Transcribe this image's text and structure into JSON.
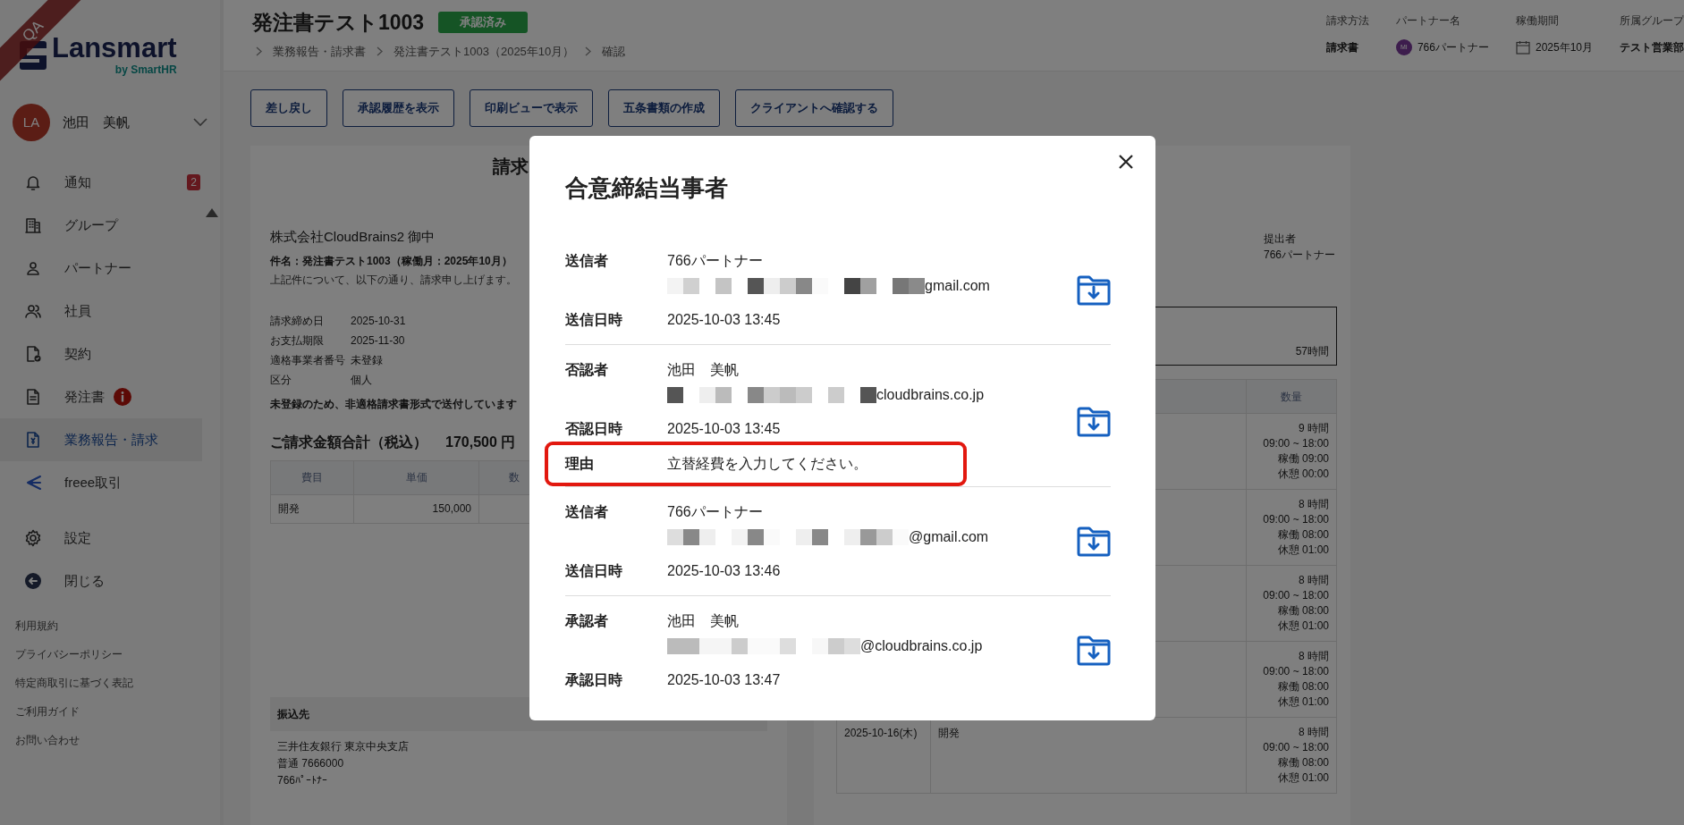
{
  "sidebar": {
    "env_ribbon": "QA",
    "logo": "Lansmart",
    "logo_sub": "by SmartHR",
    "user": {
      "initials": "LA",
      "name": "池田　美帆"
    },
    "nav": [
      {
        "label": "通知",
        "badge": "2",
        "alert": false,
        "selected": false
      },
      {
        "label": "グループ",
        "alert": false,
        "selected": false
      },
      {
        "label": "パートナー",
        "alert": false,
        "selected": false
      },
      {
        "label": "社員",
        "alert": false,
        "selected": false
      },
      {
        "label": "契約",
        "alert": false,
        "selected": false
      },
      {
        "label": "発注書",
        "alert": true,
        "selected": false
      },
      {
        "label": "業務報告・請求",
        "alert": false,
        "selected": true
      },
      {
        "label": "freee取引",
        "alert": false,
        "selected": false
      }
    ],
    "sub_nav": [
      {
        "label": "設定",
        "selected": false
      },
      {
        "label": "閉じる",
        "selected": false
      }
    ],
    "footer_links": [
      "利用規約",
      "プライバシーポリシー",
      "特定商取引に基づく表記",
      "ご利用ガイド",
      "お問い合わせ"
    ]
  },
  "header": {
    "title": "発注書テスト1003",
    "status": "承認済み",
    "breadcrumb": [
      "業務報告・請求書",
      "発注書テスト1003（2025年10月）",
      "確認"
    ],
    "meta": [
      {
        "kind": "text",
        "label": "請求方法",
        "value": "請求書"
      },
      {
        "kind": "avatar",
        "label": "パートナー名",
        "avatar": "MI",
        "value": "766パートナー"
      },
      {
        "kind": "calendar",
        "label": "稼働期間",
        "value": "2025年10月"
      },
      {
        "kind": "text",
        "label": "所属グループ",
        "value": "テスト営業部"
      }
    ]
  },
  "actions": [
    "差し戻し",
    "承認履歴を表示",
    "印刷ビューで表示",
    "五条書類の作成",
    "クライアントへ確認する"
  ],
  "invoice": {
    "title": "請求",
    "recipient": "株式会社CloudBrains2 御中",
    "subject": "件名：発注書テスト1003（稼働月：2025年10月）",
    "intro": "上記件について、以下の通り、請求申し上げます。",
    "details": [
      {
        "label": "請求締め日",
        "value": "2025-10-31"
      },
      {
        "label": "お支払期限",
        "value": "2025-11-30"
      },
      {
        "label": "適格事業者番号",
        "value": "未登録"
      },
      {
        "label": "区分",
        "value": "個人"
      }
    ],
    "notice": "未登録のため、非適格請求書形式で送付しています",
    "total_label": "ご請求金額合計（税込）",
    "total": "170,500 円",
    "table": {
      "columns": [
        "費目",
        "単価",
        "数"
      ],
      "rows": [
        [
          "開発",
          "150,000"
        ]
      ]
    },
    "bank": {
      "heading": "振込先",
      "lines": [
        "三井住友銀行 東京中央支店",
        "普通 7666000",
        "766ﾊﾟｰﾄﾅｰ"
      ]
    }
  },
  "report": {
    "submitter_label": "提出者",
    "submitter": "766パートナー",
    "total_hours": "57時間",
    "quantity_column": "数量",
    "rows": [
      {
        "quantity": [
          "9 時間",
          "09:00 ~ 18:00",
          "稼働 09:00",
          "休憩 00:00"
        ]
      },
      {
        "quantity": [
          "8 時間",
          "09:00 ~ 18:00",
          "稼働 08:00",
          "休憩 01:00"
        ]
      },
      {
        "quantity": [
          "8 時間",
          "09:00 ~ 18:00",
          "稼働 08:00",
          "休憩 01:00"
        ]
      },
      {
        "quantity": [
          "8 時間",
          "09:00 ~ 18:00",
          "稼働 08:00",
          "休憩 01:00"
        ]
      },
      {
        "date": "2025-10-16(木)",
        "item": "開発",
        "quantity": [
          "8 時間",
          "09:00 ~ 18:00",
          "稼働 08:00",
          "休憩 01:00"
        ]
      }
    ]
  },
  "modal": {
    "title": "合意締結当事者",
    "parties": [
      {
        "role_label": "送信者",
        "name": "766パートナー",
        "email": "gmail.com",
        "date_label": "送信日時",
        "date": "2025-10-03 13:45"
      },
      {
        "role_label": "否認者",
        "name": "池田　美帆",
        "email": "cloudbrains.co.jp",
        "date_label": "否認日時",
        "date": "2025-10-03 13:45",
        "reason_label": "理由",
        "reason": "立替経費を入力してください。",
        "highlighted": true
      },
      {
        "role_label": "送信者",
        "name": "766パートナー",
        "email": "@gmail.com",
        "date_label": "送信日時",
        "date": "2025-10-03 13:46"
      },
      {
        "role_label": "承認者",
        "name": "池田　美帆",
        "email": "@cloudbrains.co.jp",
        "date_label": "承認日時",
        "date": "2025-10-03 13:47"
      }
    ]
  }
}
